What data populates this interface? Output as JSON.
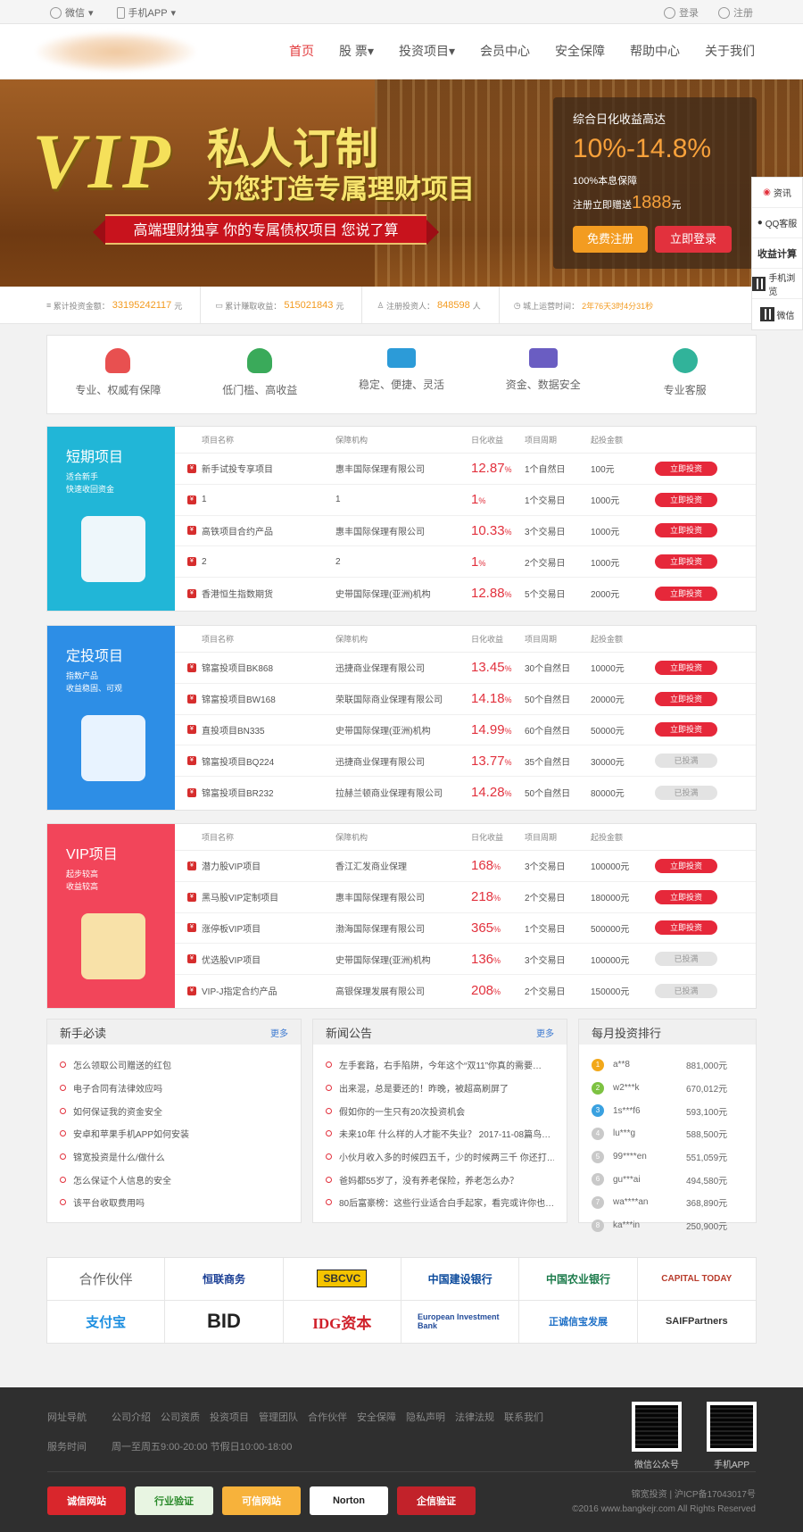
{
  "topbar": {
    "weixin": "微信",
    "app": "手机APP",
    "login": "登录",
    "register": "注册"
  },
  "nav": [
    "首页",
    "股 票",
    "投资项目",
    "会员中心",
    "安全保障",
    "帮助中心",
    "关于我们"
  ],
  "banner": {
    "vip": "VIP",
    "title1": "私人订制",
    "title2": "为您打造专属理财项目",
    "ribbon": "高端理财独享  你的专属债权项目  您说了算",
    "promo_title": "综合日化收益高达",
    "rate": "10%-14.8%",
    "guarantee": "100%本息保障",
    "gift_prefix": "注册立即赠送",
    "gift_amount": "1888",
    "gift_unit": "元",
    "btn_free": "免费注册",
    "btn_login": "立即登录"
  },
  "side": {
    "top": "资讯",
    "qq": "QQ客服",
    "calc": "收益计算",
    "mobile": "手机浏览",
    "wechat": "微信"
  },
  "stats": [
    {
      "label": "累计投资金额：",
      "value": "33195242117",
      "unit": "元"
    },
    {
      "label": "累计赚取收益：",
      "value": "515021843",
      "unit": "元"
    },
    {
      "label": "注册投资人：",
      "value": "848598",
      "unit": "人"
    },
    {
      "label": "城上运营时间：",
      "value": "2年76天3时4分31秒",
      "unit": ""
    }
  ],
  "features": [
    "专业、权威有保障",
    "低门槛、高收益",
    "稳定、便捷、灵活",
    "资金、数据安全",
    "专业客服"
  ],
  "columns": [
    "项目名称",
    "保障机构",
    "日化收益",
    "项目周期",
    "起投金额"
  ],
  "sections": [
    {
      "title": "短期项目",
      "sub1": "适合新手",
      "sub2": "快速收回资金",
      "color": "#21b6d7",
      "rows": [
        {
          "name": "新手试投专享项目",
          "org": "惠丰国际保理有限公司",
          "rate": "12.87",
          "period": "1个自然日",
          "min": "100元",
          "btn": "立即投资"
        },
        {
          "name": "1",
          "org": "1",
          "rate": "1",
          "period": "1个交易日",
          "min": "1000元",
          "btn": "立即投资"
        },
        {
          "name": "高铁项目合约产品",
          "org": "惠丰国际保理有限公司",
          "rate": "10.33",
          "period": "3个交易日",
          "min": "1000元",
          "btn": "立即投资"
        },
        {
          "name": "2",
          "org": "2",
          "rate": "1",
          "period": "2个交易日",
          "min": "1000元",
          "btn": "立即投资"
        },
        {
          "name": "香港恒生指数期货",
          "org": "史带国际保理(亚洲)机构",
          "rate": "12.88",
          "period": "5个交易日",
          "min": "2000元",
          "btn": "立即投资"
        }
      ]
    },
    {
      "title": "定投项目",
      "sub1": "指数产品",
      "sub2": "收益稳固、可观",
      "color": "#2d8ee6",
      "rows": [
        {
          "name": "锦富投项目BK868",
          "org": "迅捷商业保理有限公司",
          "rate": "13.45",
          "period": "30个自然日",
          "min": "10000元",
          "btn": "立即投资"
        },
        {
          "name": "锦富投项目BW168",
          "org": "荣联国际商业保理有限公司",
          "rate": "14.18",
          "period": "50个自然日",
          "min": "20000元",
          "btn": "立即投资"
        },
        {
          "name": "直投项目BN335",
          "org": "史带国际保理(亚洲)机构",
          "rate": "14.99",
          "period": "60个自然日",
          "min": "50000元",
          "btn": "立即投资"
        },
        {
          "name": "锦富投项目BQ224",
          "org": "迅捷商业保理有限公司",
          "rate": "13.77",
          "period": "35个自然日",
          "min": "30000元",
          "btn": "已投满"
        },
        {
          "name": "锦富投项目BR232",
          "org": "拉赫兰顿商业保理有限公司",
          "rate": "14.28",
          "period": "50个自然日",
          "min": "80000元",
          "btn": "已投满"
        }
      ]
    },
    {
      "title": "VIP项目",
      "sub1": "起步较高",
      "sub2": "收益较高",
      "color": "#f2455a",
      "rows": [
        {
          "name": "潜力股VIP项目",
          "org": "香江汇发商业保理",
          "rate": "168",
          "period": "3个交易日",
          "min": "100000元",
          "btn": "立即投资"
        },
        {
          "name": "黑马股VIP定制项目",
          "org": "惠丰国际保理有限公司",
          "rate": "218",
          "period": "2个交易日",
          "min": "180000元",
          "btn": "立即投资"
        },
        {
          "name": "涨停板VIP项目",
          "org": "渤海国际保理有限公司",
          "rate": "365",
          "period": "1个交易日",
          "min": "500000元",
          "btn": "立即投资"
        },
        {
          "name": "优选股VIP项目",
          "org": "史带国际保理(亚洲)机构",
          "rate": "136",
          "period": "3个交易日",
          "min": "100000元",
          "btn": "已投满"
        },
        {
          "name": "VIP-J指定合约产品",
          "org": "高银保理发展有限公司",
          "rate": "208",
          "period": "2个交易日",
          "min": "150000元",
          "btn": "已投满"
        }
      ]
    }
  ],
  "newbie": {
    "title": "新手必读",
    "more": "更多",
    "items": [
      "怎么领取公司赠送的红包",
      "电子合同有法律效应吗",
      "如何保证我的资金安全",
      "安卓和苹果手机APP如何安装",
      "锦宽投资是什么/做什么",
      "怎么保证个人信息的安全",
      "该平台收取费用吗"
    ]
  },
  "news": {
    "title": "新闻公告",
    "more": "更多",
    "items": [
      "左手套路，右手陷阱，今年这个“双11”你真的需要…",
      "出来混，总是要还的！昨晚，被超高刷屏了",
      "假如你的一生只有20次投资机会",
      "未来10年 什么样的人才能不失业？ 2017-11-08篇鸟…",
      "小伙月收入多的时候四五千，少的时候两三千 你还打…",
      "爸妈都55岁了，没有养老保险，养老怎么办？",
      "80后富豪榜：这些行业适合白手起家，看完或许你也…"
    ]
  },
  "ranking": {
    "title": "每月投资排行",
    "items": [
      {
        "name": "a**8",
        "amount": "881,000元"
      },
      {
        "name": "w2***k",
        "amount": "670,012元"
      },
      {
        "name": "1s***f6",
        "amount": "593,100元"
      },
      {
        "name": "lu***g",
        "amount": "588,500元"
      },
      {
        "name": "99****en",
        "amount": "551,059元"
      },
      {
        "name": "gu***ai",
        "amount": "494,580元"
      },
      {
        "name": "wa****an",
        "amount": "368,890元"
      },
      {
        "name": "ka***in",
        "amount": "250,900元"
      }
    ]
  },
  "partners": {
    "title": "合作伙伴",
    "logos": [
      "恒联商务",
      "SBCVC",
      "中国建设银行",
      "中国农业银行",
      "CAPITAL TODAY",
      "支付宝",
      "BID",
      "IDG资本",
      "European Investment Bank",
      "正诚信宝发展",
      "SAIFPartners"
    ]
  },
  "footer": {
    "nav_label": "网址导航",
    "links": [
      "公司介绍",
      "公司资质",
      "投资项目",
      "管理团队",
      "合作伙伴",
      "安全保障",
      "隐私声明",
      "法律法规",
      "联系我们"
    ],
    "hours_label": "服务时间",
    "hours": "周一至周五9:00-20:00 节假日10:00-18:00",
    "qr1": "微信公众号",
    "qr2": "手机APP",
    "badges": [
      "诚信网站",
      "行业验证",
      "可信网站",
      "Norton",
      "企信验证"
    ],
    "copy1": "锦宽投资  |  沪ICP备17043017号",
    "copy2": "©2016 www.bangkejr.com All Rights Reserved"
  }
}
